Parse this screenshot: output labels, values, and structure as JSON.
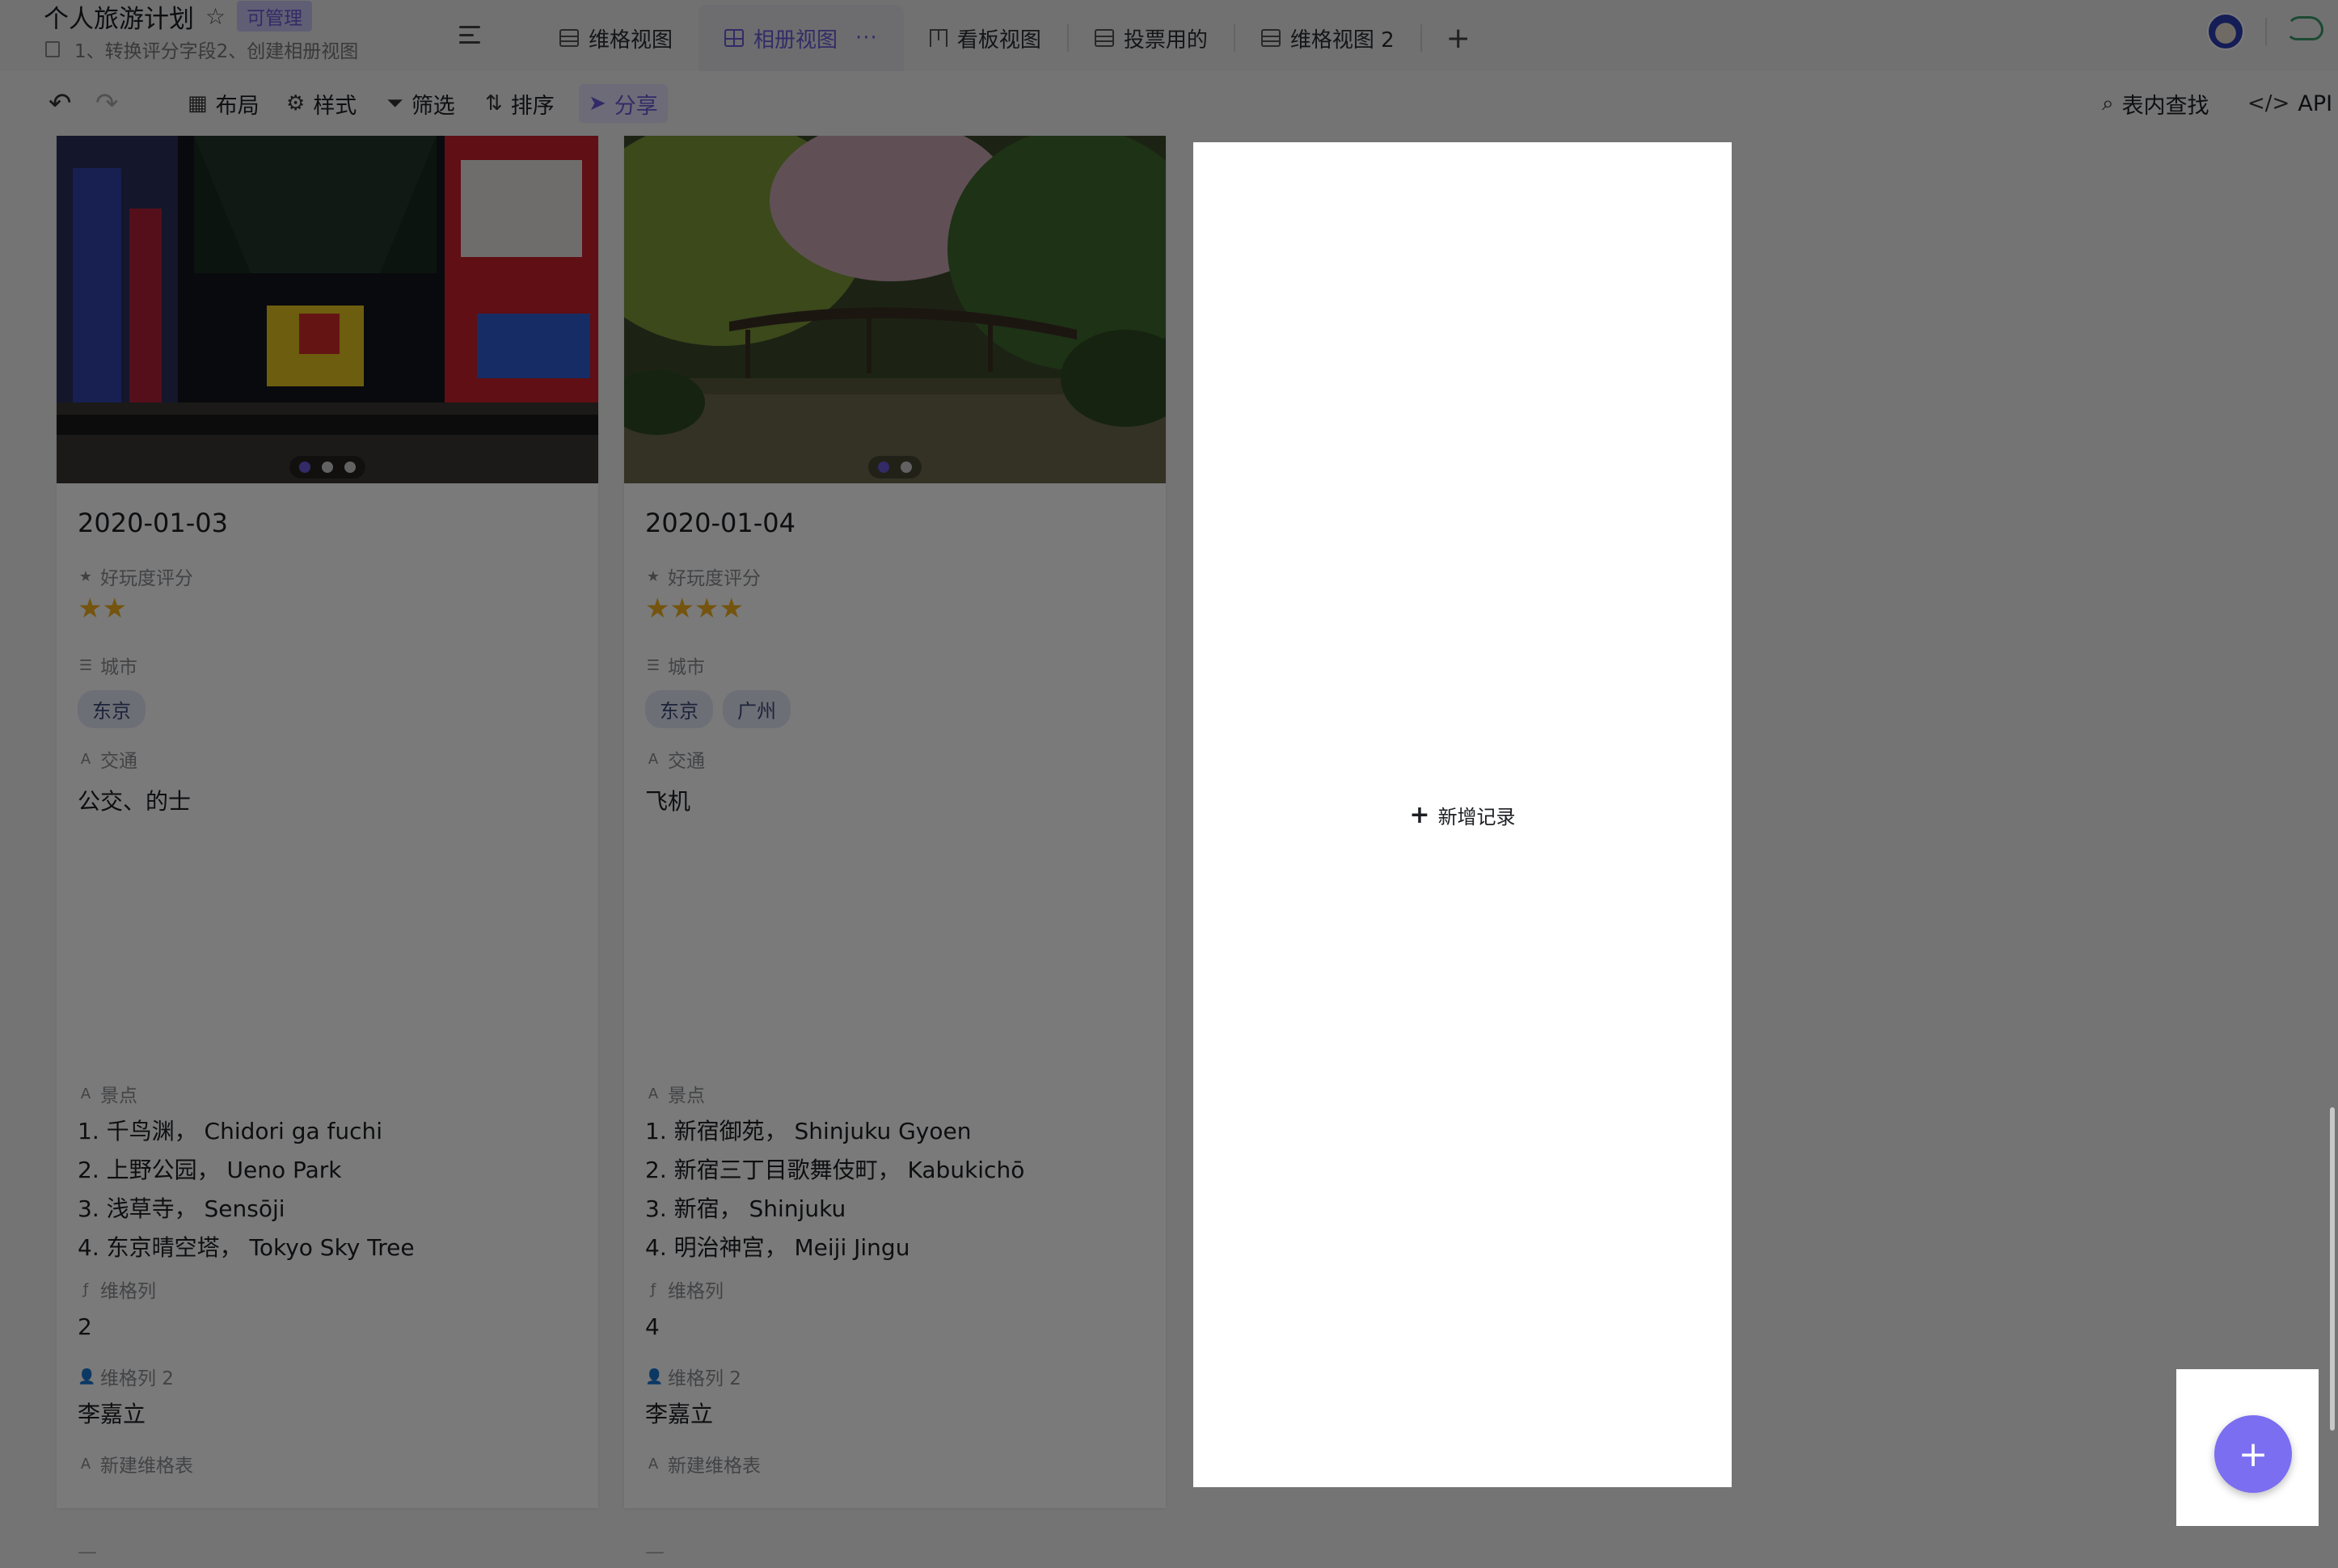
{
  "header": {
    "title": "个人旅游计划",
    "badge": "可管理",
    "subtitle": "1、转换评分字段2、创建相册视图",
    "tabs": [
      {
        "label": "维格视图"
      },
      {
        "label": "相册视图",
        "more": "···"
      },
      {
        "label": "看板视图"
      },
      {
        "label": "投票用的"
      },
      {
        "label": "维格视图 2"
      }
    ],
    "add_tab": "+"
  },
  "toolbar": {
    "layout": "布局",
    "style": "样式",
    "filter": "筛选",
    "sort": "排序",
    "share": "分享",
    "search": "表内查找",
    "api": "API"
  },
  "cards": [
    {
      "title": "2020-01-03",
      "rating_label": "好玩度评分",
      "rating": 2,
      "rating_stars": "★★",
      "city_label": "城市",
      "cities": [
        "东京"
      ],
      "transport_label": "交通",
      "transport": "公交、的士",
      "spots_label": "景点",
      "spots": [
        "1. 千鸟渊， Chidori ga fuchi",
        "2. 上野公园， Ueno Park",
        "3. 浅草寺， Sensōji",
        "4. 东京晴空塔， Tokyo Sky Tree"
      ],
      "col_label": "维格列",
      "col_value": "2",
      "col2_label": "维格列 2",
      "col2_value": "李嘉立",
      "new_label": "新建维格表",
      "new_value": "—",
      "image_count": 3
    },
    {
      "title": "2020-01-04",
      "rating_label": "好玩度评分",
      "rating": 4,
      "rating_stars": "★★★★",
      "city_label": "城市",
      "cities": [
        "东京",
        "广州"
      ],
      "transport_label": "交通",
      "transport": "飞机",
      "spots_label": "景点",
      "spots": [
        "1. 新宿御苑， Shinjuku Gyoen",
        "2. 新宿三丁目歌舞伎町， Kabukichō",
        "3. 新宿， Shinjuku",
        "4. 明治神宫， Meiji Jingu"
      ],
      "col_label": "维格列",
      "col_value": "4",
      "col2_label": "维格列 2",
      "col2_value": "李嘉立",
      "new_label": "新建维格表",
      "new_value": "—",
      "image_count": 2
    }
  ],
  "add_record": "新增记录",
  "fab": "+",
  "colors": {
    "accent": "#6a5bd8",
    "fab": "#7b6ef0",
    "star": "#f2b01e"
  }
}
